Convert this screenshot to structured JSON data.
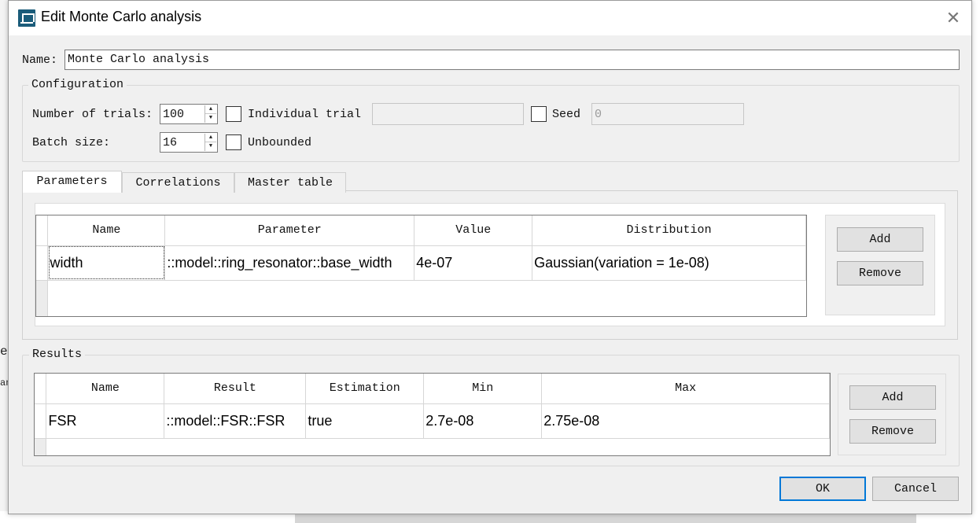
{
  "window": {
    "title": "Edit Monte Carlo analysis",
    "close_glyph": "✕"
  },
  "name_field": {
    "label": "Name:",
    "value": "Monte Carlo analysis"
  },
  "configuration": {
    "title": "Configuration",
    "trials_label": "Number of trials:",
    "trials_value": "100",
    "individual_trial_label": "Individual trial",
    "individual_trial_checked": false,
    "individual_trial_value": "",
    "seed_label": "Seed",
    "seed_checked": false,
    "seed_value": "0",
    "batch_label": "Batch size:",
    "batch_value": "16",
    "unbounded_label": "Unbounded",
    "unbounded_checked": false
  },
  "tabs": [
    {
      "label": "Parameters",
      "active": true
    },
    {
      "label": "Correlations",
      "active": false
    },
    {
      "label": "Master table",
      "active": false
    }
  ],
  "parameters": {
    "columns": [
      "Name",
      "Parameter",
      "Value",
      "Distribution"
    ],
    "rows": [
      [
        "width",
        "::model::ring_resonator::base_width",
        "4e-07",
        "Gaussian(variation = 1e-08)"
      ]
    ],
    "add_label": "Add",
    "remove_label": "Remove"
  },
  "results": {
    "title": "Results",
    "columns": [
      "Name",
      "Result",
      "Estimation",
      "Min",
      "Max"
    ],
    "rows": [
      [
        "FSR",
        "::model::FSR::FSR",
        "true",
        "2.7e-08",
        "2.75e-08"
      ]
    ],
    "add_label": "Add",
    "remove_label": "Remove"
  },
  "footer": {
    "ok_label": "OK",
    "cancel_label": "Cancel"
  },
  "background_peek": {
    "text_1": "es",
    "text_2": "an"
  },
  "colors": {
    "accent": "#0078d7",
    "icon": "#1b5c7a"
  }
}
